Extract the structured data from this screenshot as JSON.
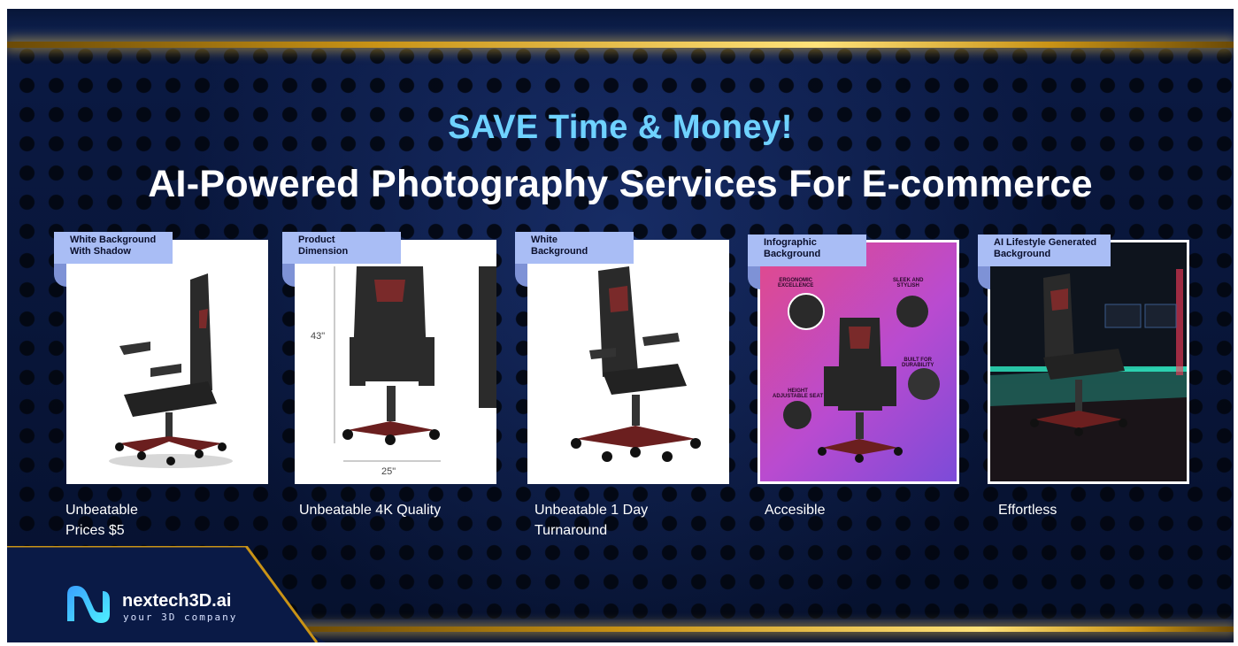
{
  "headline": {
    "top": "SAVE Time & Money!",
    "main": "AI-Powered Photography Services For E-commerce"
  },
  "cards": [
    {
      "tag": "White Background\nWith Shadow",
      "caption": "Unbeatable\nPrices $5"
    },
    {
      "tag": "Product\nDimension",
      "caption": "Unbeatable 4K Quality",
      "dim_height": "43\"",
      "dim_width": "25\""
    },
    {
      "tag": "White\nBackground",
      "caption": "Unbeatable 1 Day\nTurnaround"
    },
    {
      "tag": "Infographic\nBackground",
      "caption": "Accesible",
      "labels": {
        "ergonomic": "ERGONOMIC\nEXCELLENCE",
        "sleek": "SLEEK AND\nSTYLISH",
        "built": "BUILT FOR\nDURABILITY",
        "height": "HEIGHT\nADJUSTABLE SEAT"
      }
    },
    {
      "tag": "AI Lifestyle Generated\nBackground",
      "caption": "Effortless"
    }
  ],
  "logo": {
    "name": "nextech3D.ai",
    "tagline": "your 3D company"
  },
  "colors": {
    "accent_blue": "#6fd2ff",
    "tag_bg": "#a9bdf5",
    "gold": "#ffd34d",
    "background": "#0b1a44"
  }
}
